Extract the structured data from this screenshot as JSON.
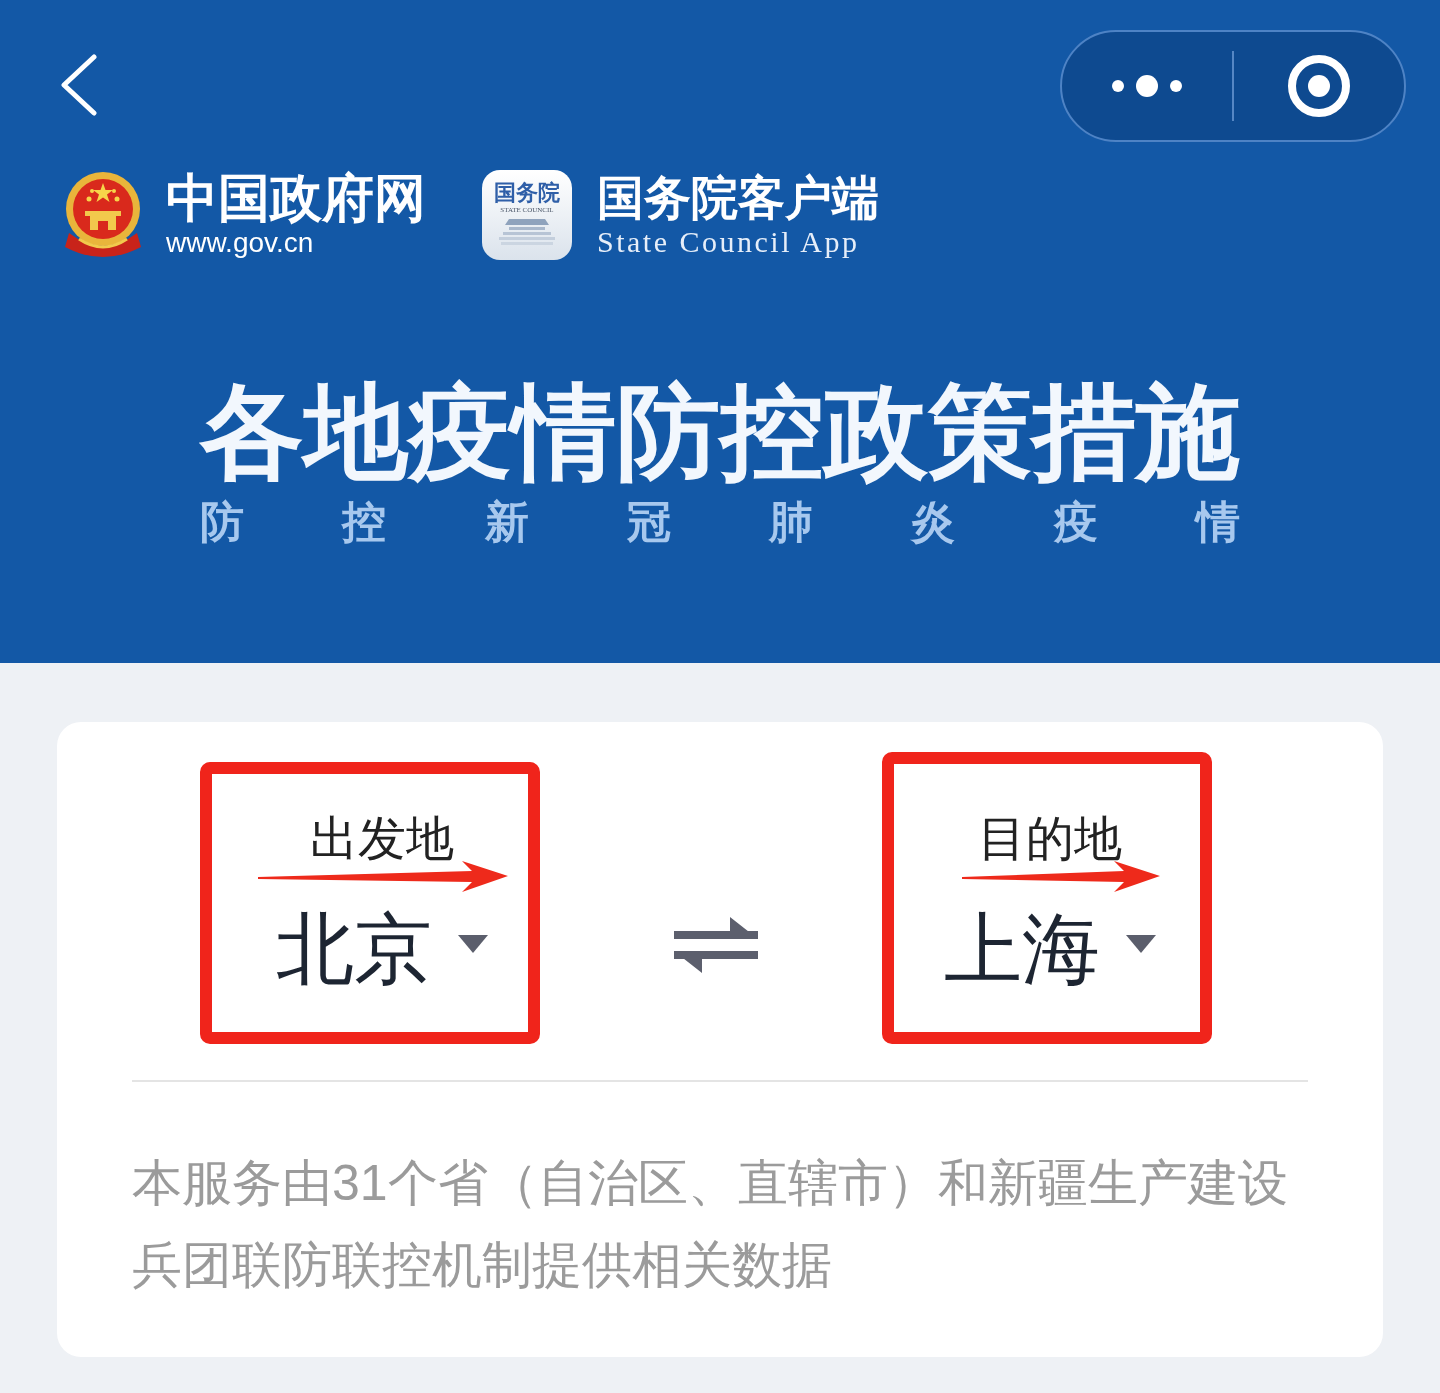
{
  "logos": [
    {
      "kind": "emblem",
      "title": "中国政府网",
      "subtitle": "www.gov.cn"
    },
    {
      "kind": "app",
      "icon_text": "国务院",
      "icon_subtext": "STATE COUNCIL",
      "title": "国务院客户端",
      "subtitle": "State Council App"
    }
  ],
  "banner": {
    "title": "各地疫情防控政策措施",
    "subtitle": "防 控 新 冠 肺 炎 疫 情"
  },
  "route": {
    "origin": {
      "label": "出发地",
      "value": "北京"
    },
    "destination": {
      "label": "目的地",
      "value": "上海"
    }
  },
  "note": "本服务由31个省（自治区、直辖市）和新疆生产建设兵团联防联控机制提供相关数据"
}
